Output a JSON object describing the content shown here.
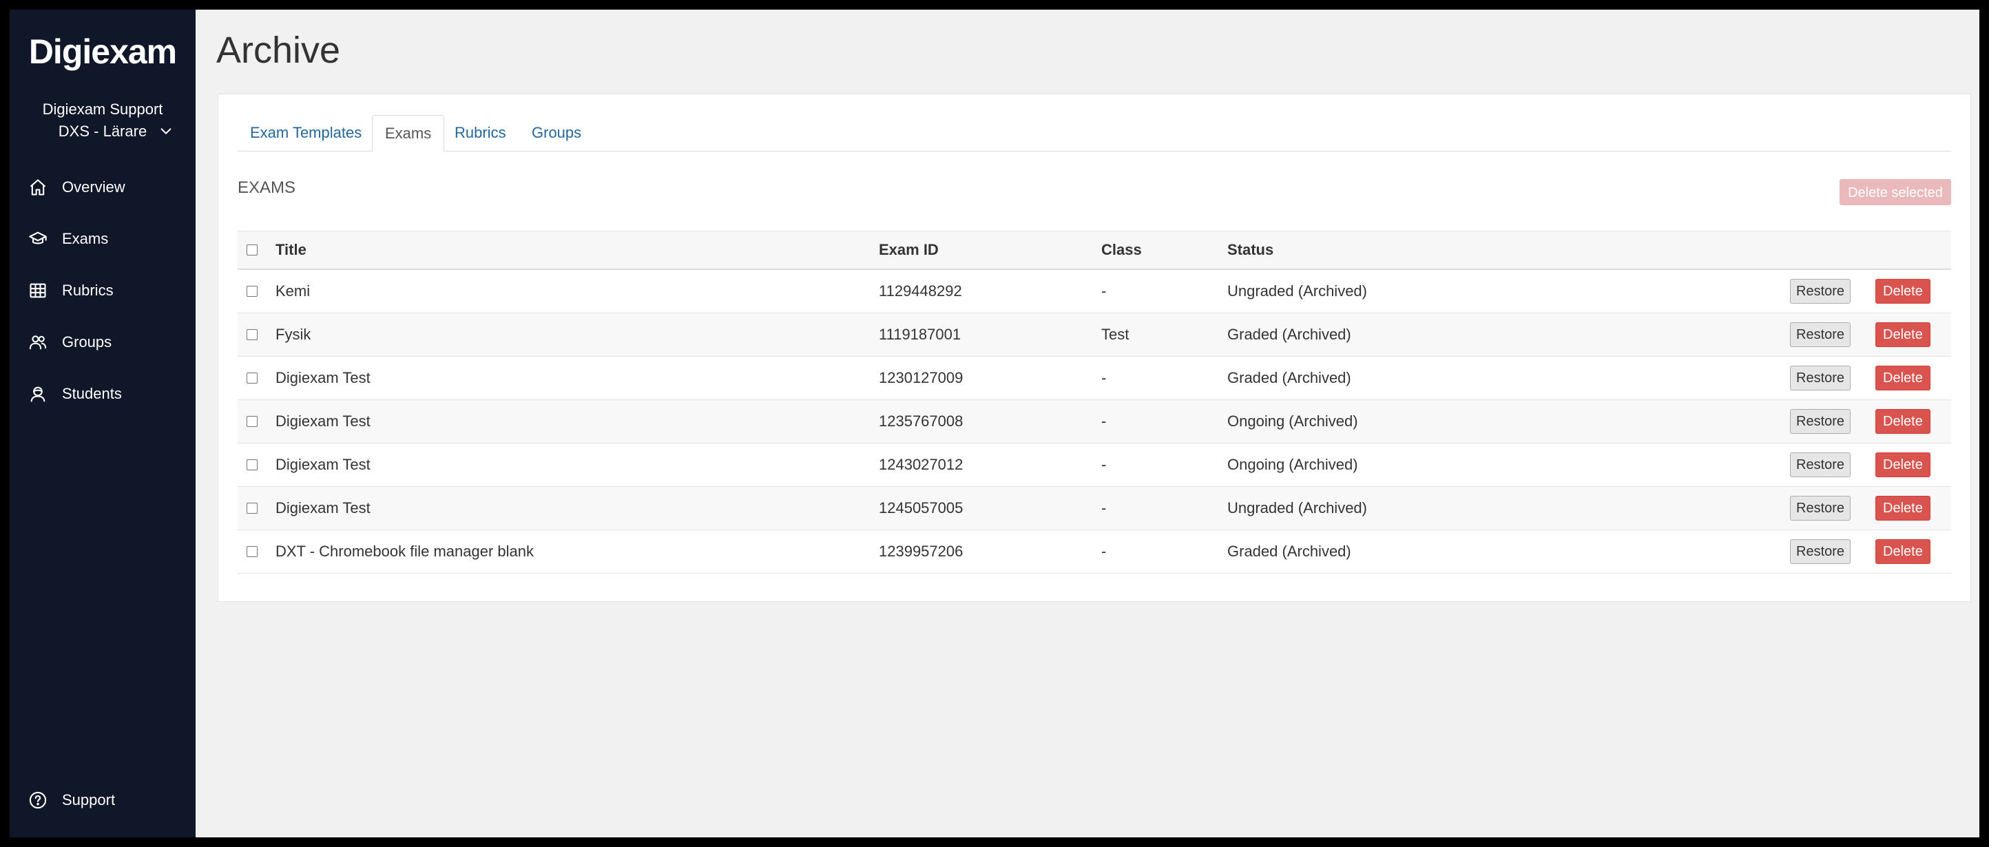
{
  "sidebar": {
    "logo": "Digiexam",
    "user_name": "Digiexam Support",
    "user_role": "DXS - Lärare",
    "items": [
      {
        "label": "Overview",
        "icon": "home-icon"
      },
      {
        "label": "Exams",
        "icon": "graduation-cap-icon"
      },
      {
        "label": "Rubrics",
        "icon": "table-icon"
      },
      {
        "label": "Groups",
        "icon": "users-icon"
      },
      {
        "label": "Students",
        "icon": "student-icon"
      }
    ],
    "support": {
      "label": "Support",
      "icon": "help-circle-icon"
    }
  },
  "page": {
    "title": "Archive"
  },
  "tabs": [
    {
      "label": "Exam Templates",
      "active": false
    },
    {
      "label": "Exams",
      "active": true
    },
    {
      "label": "Rubrics",
      "active": false
    },
    {
      "label": "Groups",
      "active": false
    }
  ],
  "section": {
    "title": "EXAMS",
    "delete_selected_label": "Delete selected"
  },
  "table": {
    "headers": {
      "title": "Title",
      "exam_id": "Exam ID",
      "class": "Class",
      "status": "Status"
    },
    "restore_label": "Restore",
    "delete_label": "Delete",
    "rows": [
      {
        "title": "Kemi",
        "exam_id": "1129448292",
        "class": "-",
        "status": "Ungraded (Archived)"
      },
      {
        "title": "Fysik",
        "exam_id": "1119187001",
        "class": "Test",
        "status": "Graded (Archived)"
      },
      {
        "title": "Digiexam Test",
        "exam_id": "1230127009",
        "class": "-",
        "status": "Graded (Archived)"
      },
      {
        "title": "Digiexam Test",
        "exam_id": "1235767008",
        "class": "-",
        "status": "Ongoing (Archived)"
      },
      {
        "title": "Digiexam Test",
        "exam_id": "1243027012",
        "class": "-",
        "status": "Ongoing (Archived)"
      },
      {
        "title": "Digiexam Test",
        "exam_id": "1245057005",
        "class": "-",
        "status": "Ungraded (Archived)"
      },
      {
        "title": "DXT - Chromebook file manager blank",
        "exam_id": "1239957206",
        "class": "-",
        "status": "Graded (Archived)"
      }
    ]
  },
  "colors": {
    "sidebar_bg": "#0f1729",
    "link": "#23679e",
    "danger": "#d9534f",
    "danger_disabled": "#eab9bb"
  }
}
